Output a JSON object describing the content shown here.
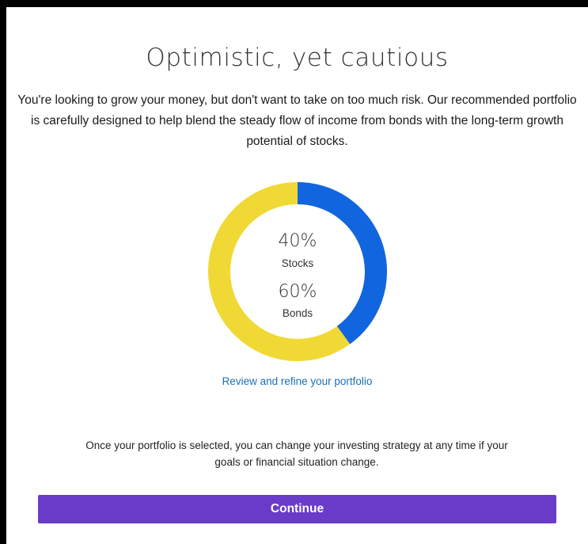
{
  "header": {
    "title": "Optimistic, yet cautious"
  },
  "description": "You're looking to grow your money, but don't want to take on too much risk. Our recommended portfolio is carefully designed to help blend the steady flow of income from bonds with the long-term growth potential of stocks.",
  "allocation": {
    "stocks": {
      "percent_label": "40%",
      "label": "Stocks",
      "value": 40,
      "color": "#1166e0"
    },
    "bonds": {
      "percent_label": "60%",
      "label": "Bonds",
      "value": 60,
      "color": "#f0d934"
    }
  },
  "review_link": "Review and refine your portfolio",
  "note": "Once your portfolio is selected, you can change your investing strategy at any time if your goals or financial situation change.",
  "continue_label": "Continue",
  "colors": {
    "accent_button": "#6a3bc9",
    "link": "#1b6fb5"
  }
}
